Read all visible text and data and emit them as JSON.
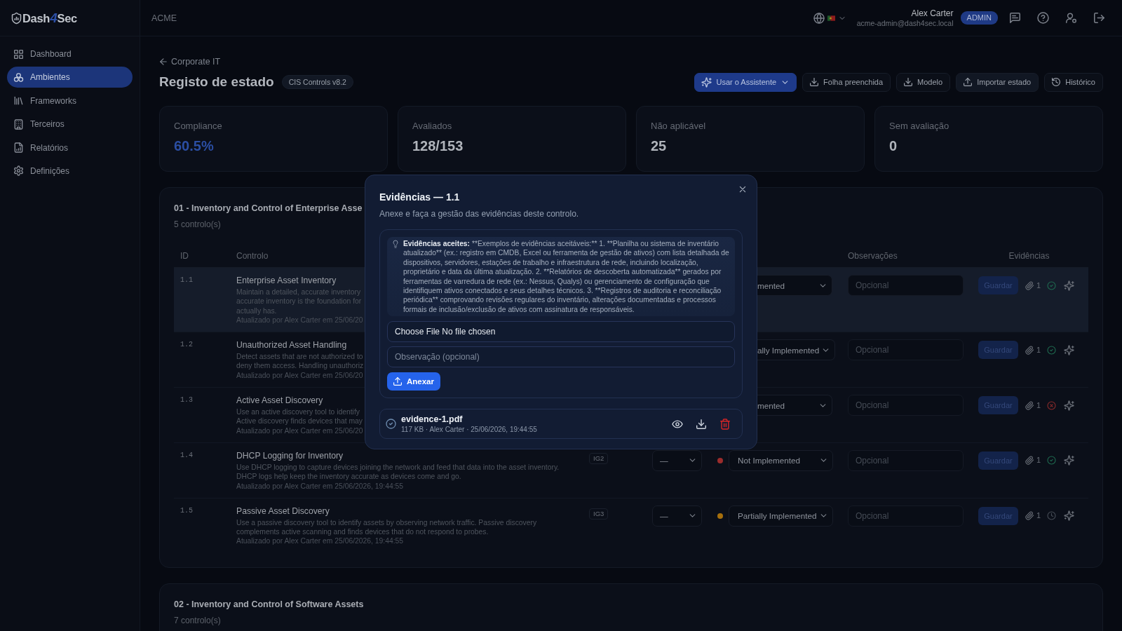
{
  "sidebar": {
    "logo": {
      "before": "Dash",
      "accent": "4",
      "after": "Sec"
    },
    "items": [
      {
        "label": "Dashboard",
        "selected": false
      },
      {
        "label": "Ambientes",
        "selected": true
      },
      {
        "label": "Frameworks",
        "selected": false
      },
      {
        "label": "Terceiros",
        "selected": false
      },
      {
        "label": "Relatórios",
        "selected": false
      },
      {
        "label": "Definições",
        "selected": false
      }
    ]
  },
  "topbar": {
    "tenant": "ACME",
    "user": {
      "name": "Alex Carter",
      "email": "acme-admin@dash4sec.local",
      "role": "ADMIN"
    }
  },
  "page": {
    "back_link": "Corporate IT",
    "title": "Registo de estado",
    "framework": "CIS Controls v8.2",
    "actions": [
      {
        "label": "Usar o Assistente",
        "kind": "assistant"
      },
      {
        "label": "Folha preenchida",
        "kind": "download"
      },
      {
        "label": "Modelo",
        "kind": "download"
      },
      {
        "label": "Importar estado",
        "kind": "import"
      },
      {
        "label": "Histórico",
        "kind": "history"
      }
    ]
  },
  "stats": [
    {
      "label": "Compliance",
      "value": "60.5%",
      "highlighted": true
    },
    {
      "label": "Avaliados",
      "value": "128/153",
      "highlighted": false
    },
    {
      "label": "Não aplicável",
      "value": "25",
      "highlighted": false
    },
    {
      "label": "Sem avaliação",
      "value": "0",
      "highlighted": false
    }
  ],
  "sections": [
    {
      "title": "01 - Inventory and Control of Enterprise Asse",
      "count": "5 controlo(s)",
      "columns": [
        "ID",
        "Controlo",
        "Observações",
        "Evidências"
      ],
      "rows": [
        {
          "id": "1.1",
          "title": "Enterprise Asset Inventory",
          "description_lines": [
            "Maintain a detailed, accurate inventory",
            "accurate inventory is the foundation for",
            "actually has."
          ],
          "updated": "Atualizado por Alex Carter em 25/06/20",
          "selected": true,
          "status": {
            "value": "mented"
          },
          "notes": {
            "placeholder": "Opcional"
          },
          "save": {
            "label": "Guardar",
            "disabled": true
          },
          "evidence": {
            "count": "1",
            "kind": "approved"
          }
        },
        {
          "id": "1.2",
          "title": "Unauthorized Asset Handling",
          "description_lines": [
            "Detect assets that are not authorized to",
            "deny them access. Handling unauthoriz"
          ],
          "updated": "Atualizado por Alex Carter em 25/06/20",
          "selected": false,
          "status": {
            "value": "ally Implemented"
          },
          "notes": {
            "placeholder": "Opcional"
          },
          "save": {
            "label": "Guardar",
            "disabled": true
          },
          "evidence": {
            "count": "1",
            "kind": "approved"
          }
        },
        {
          "id": "1.3",
          "title": "Active Asset Discovery",
          "description_lines": [
            "Use an active discovery tool to identify",
            "Active discovery finds devices that may"
          ],
          "updated": "Atualizado por Alex Carter em 25/06/20",
          "selected": false,
          "status": {
            "value": "mented"
          },
          "notes": {
            "placeholder": "Opcional"
          },
          "save": {
            "label": "Guardar",
            "disabled": true
          },
          "evidence": {
            "count": "1",
            "kind": "rejected"
          }
        },
        {
          "id": "1.4",
          "title": "DHCP Logging for Inventory",
          "description_lines": [
            "Use DHCP logging to capture devices joining the network and feed that data into the asset inventory.",
            "DHCP logs help keep the inventory accurate as devices come and go."
          ],
          "updated": "Atualizado por Alex Carter em 25/06/2026, 19:44:55",
          "selected": false,
          "ig": "IG2",
          "maturity": "—",
          "status": {
            "value": "Not Implemented",
            "color": "#9b2c2c"
          },
          "notes": {
            "placeholder": "Opcional"
          },
          "save": {
            "label": "Guardar",
            "disabled": true
          },
          "evidence": {
            "count": "1",
            "kind": "approved"
          }
        },
        {
          "id": "1.5",
          "title": "Passive Asset Discovery",
          "description_lines": [
            "Use a passive discovery tool to identify assets by observing network traffic. Passive discovery",
            "complements active scanning and finds devices that do not respond to probes."
          ],
          "updated": "Atualizado por Alex Carter em 25/06/2026, 19:44:55",
          "selected": false,
          "ig": "IG3",
          "maturity": "—",
          "status": {
            "value": "Partially Implemented",
            "color": "#a66f0c"
          },
          "notes": {
            "placeholder": "Opcional"
          },
          "save": {
            "label": "Guardar",
            "disabled": true
          },
          "evidence": {
            "count": "1",
            "kind": "pending"
          }
        }
      ]
    },
    {
      "title": "02 - Inventory and Control of Software Assets",
      "count": "7 controlo(s)"
    }
  ],
  "dialog": {
    "title": "Evidências — 1.1",
    "subtitle": "Anexe e faça a gestão das evidências deste controlo.",
    "hint": {
      "label": "Evidências aceites:",
      "lines": [
        "**Exemplos de evidências aceitáveis:** 1. **Planilha ou sistema de inventário",
        "atualizado** (ex.: registro em CMDB, Excel ou ferramenta de gestão de ativos) com lista detalhada de",
        "dispositivos, servidores, estações de trabalho e infraestrutura de rede, incluindo localização,",
        "proprietário e data da última atualização. 2. **Relatórios de descoberta automatizada** gerados por",
        "ferramentas de varredura de rede (ex.: Nessus, Qualys) ou gerenciamento de configuração que",
        "identifiquem ativos conectados e seus detalhes técnicos. 3. **Registros de auditoria e reconciliação",
        "periódica** comprovando revisões regulares do inventário, alterações documentadas e processos",
        "formais de inclusão/exclusão de ativos com assinatura de responsáveis."
      ]
    },
    "file_input": "Choose File No file chosen",
    "note": {
      "placeholder": "Observação (opcional)"
    },
    "attach_button": "Anexar",
    "files": [
      {
        "name": "evidence-1.pdf",
        "meta": "117 KB · Alex Carter · 25/06/2026, 19:44:55"
      }
    ]
  }
}
